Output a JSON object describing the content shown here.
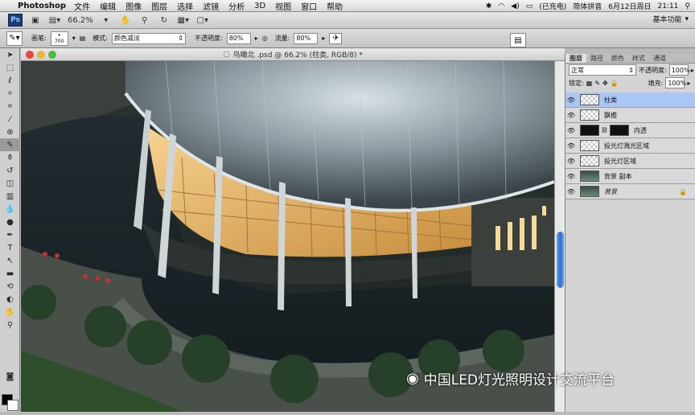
{
  "menubar": {
    "app": "Photoshop",
    "items": [
      "文件",
      "编辑",
      "图像",
      "图层",
      "选择",
      "滤镜",
      "分析",
      "3D",
      "视图",
      "窗口",
      "帮助"
    ],
    "status": "(已充电)",
    "input": "简体拼音",
    "date": "6月12日周日",
    "time": "21:11"
  },
  "appbar": {
    "ps": "Ps",
    "zoom": "66.2%",
    "workspace": "基本功能"
  },
  "options": {
    "brush_label": "画笔:",
    "brush_size": "700",
    "mode_label": "模式:",
    "mode_value": "颜色减淡",
    "opacity_label": "不透明度:",
    "opacity_value": "80%",
    "flow_label": "流量:",
    "flow_value": "80%"
  },
  "document": {
    "title": "鸟瞰北 .psd @ 66.2% (柱类, RGB/8) *"
  },
  "layers_panel": {
    "tabs": [
      "图层",
      "路径",
      "颜色",
      "样式",
      "通道"
    ],
    "blend_mode": "正常",
    "opacity_label": "不透明度:",
    "opacity_value": "100%",
    "lock_label": "锁定:",
    "fill_label": "填充:",
    "fill_value": "100%",
    "layers": [
      {
        "name": "柱类",
        "selected": true,
        "thumb": "transparent"
      },
      {
        "name": "飘檐",
        "selected": false,
        "thumb": "transparent"
      },
      {
        "name": "内透",
        "selected": false,
        "thumb": "dark"
      },
      {
        "name": "投光灯溅光区域",
        "selected": false,
        "thumb": "transparent"
      },
      {
        "name": "投光灯区域",
        "selected": false,
        "thumb": "transparent"
      },
      {
        "name": "背景 副本",
        "selected": false,
        "thumb": "image"
      },
      {
        "name": "背景",
        "selected": false,
        "thumb": "image"
      }
    ]
  },
  "watermark": {
    "text": "中国LED灯光照明设计交流平台"
  }
}
